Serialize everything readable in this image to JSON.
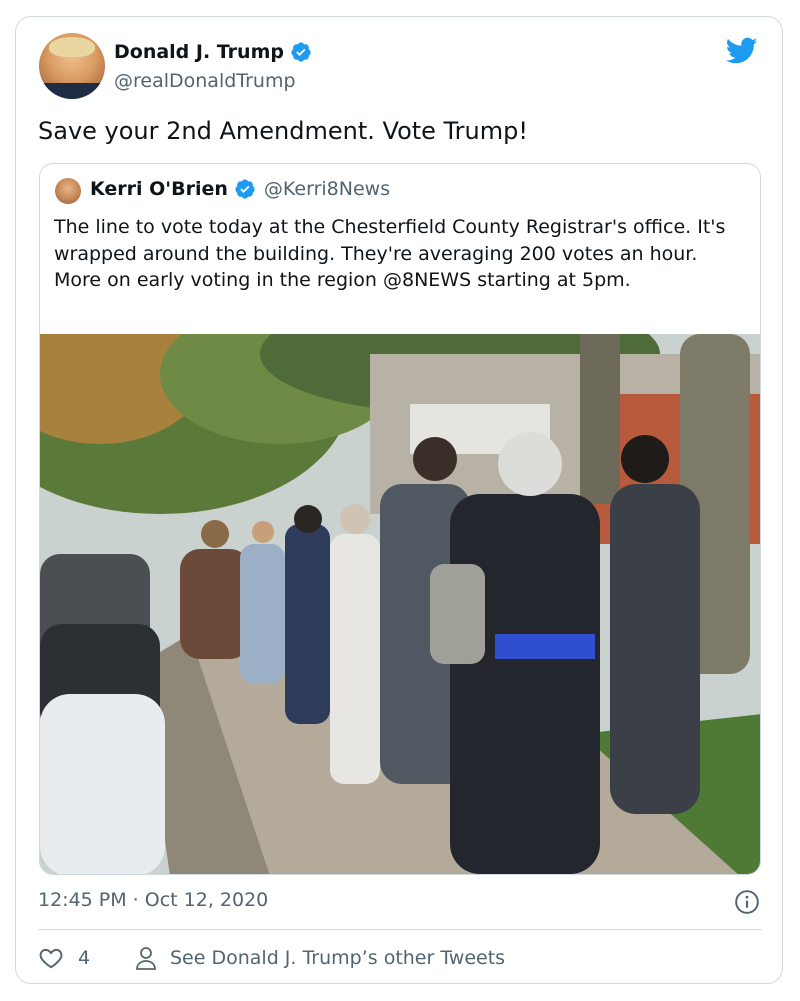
{
  "tweet": {
    "author_name": "Donald J. Trump",
    "author_handle": "@realDonaldTrump",
    "text": "Save your 2nd Amendment. Vote Trump!",
    "timestamp": "12:45 PM · Oct 12, 2020",
    "like_count": "4",
    "other_tweets_link": "See Donald J. Trump’s other Tweets"
  },
  "quoted_tweet": {
    "author_name": "Kerri O'Brien",
    "author_handle": "@Kerri8News",
    "text": "The line to vote today at the Chesterfield County Registrar's office. It's wrapped around the building. They're averaging 200 votes an hour. More on early voting in the region @8NEWS starting at 5pm."
  },
  "icons": {
    "brand": "twitter-bird-icon",
    "verified": "verified-badge-icon",
    "info": "info-icon",
    "like": "heart-icon",
    "profile": "person-icon"
  },
  "colors": {
    "brand_blue": "#1d9bf0",
    "text_primary": "#0f1419",
    "text_secondary": "#536471",
    "border": "#cfd9de"
  }
}
